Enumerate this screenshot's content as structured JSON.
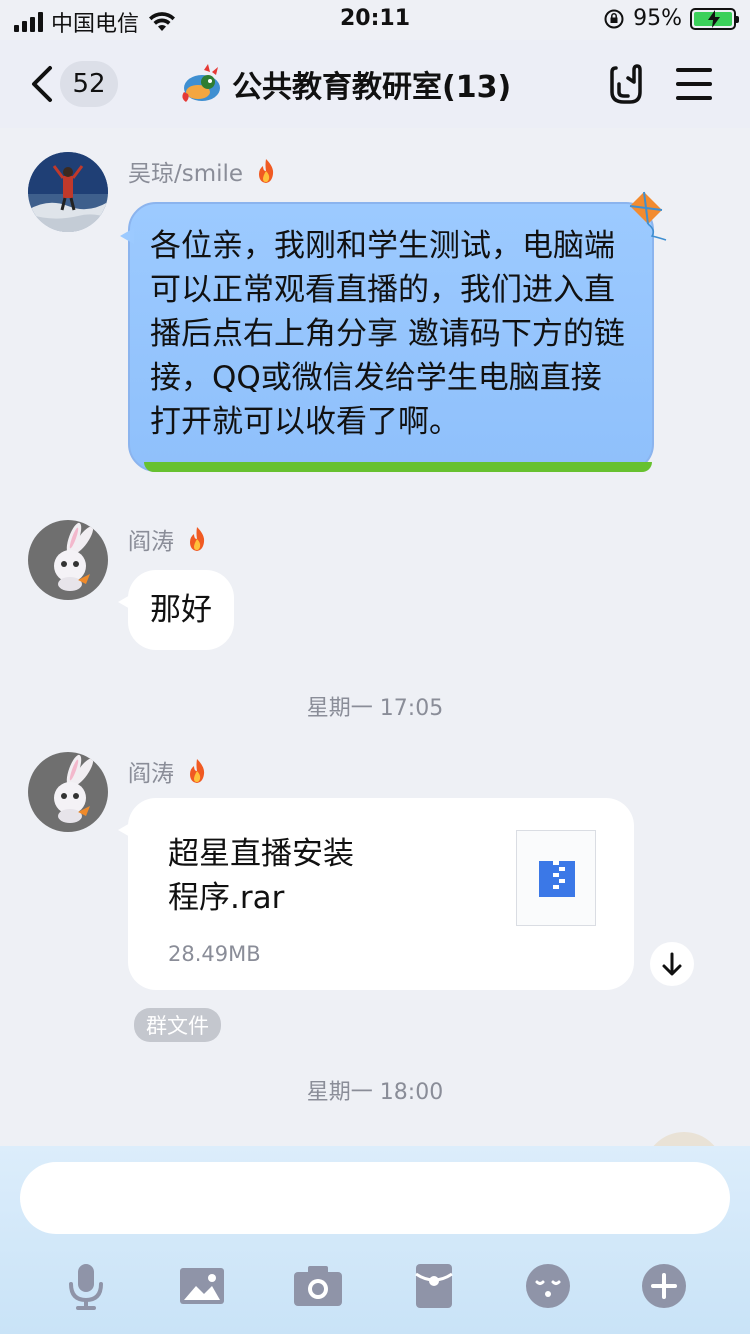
{
  "status_bar": {
    "carrier": "中国电信",
    "time": "20:11",
    "battery": "95%"
  },
  "nav": {
    "unread_count": "52",
    "title": "公共教育教研室(13)"
  },
  "messages": [
    {
      "sender": "吴琼/smile",
      "text": "各位亲，我刚和学生测试，电脑端可以正常观看直播的，我们进入直播后点右上角分享 邀请码下方的链接，QQ或微信发给学生电脑直接打开就可以收看了啊。"
    },
    {
      "sender": "阎涛",
      "text": "那好"
    },
    {
      "timestamp": "星期一 17:05"
    },
    {
      "sender": "阎涛",
      "file": {
        "name_line1": "超星直播安装",
        "name_line2": "程序.rar",
        "size": "28.49MB",
        "tag": "群文件"
      }
    },
    {
      "timestamp": "星期一 18:00"
    }
  ],
  "input": {
    "placeholder": ""
  },
  "colors": {
    "accent_blue": "#9ccaff",
    "grass_green": "#67c12f",
    "battery_green": "#3bd05a",
    "icon_gray": "#8f94a8"
  },
  "icons": [
    "microphone-icon",
    "image-icon",
    "camera-icon",
    "red-packet-icon",
    "emoji-icon",
    "plus-icon"
  ]
}
